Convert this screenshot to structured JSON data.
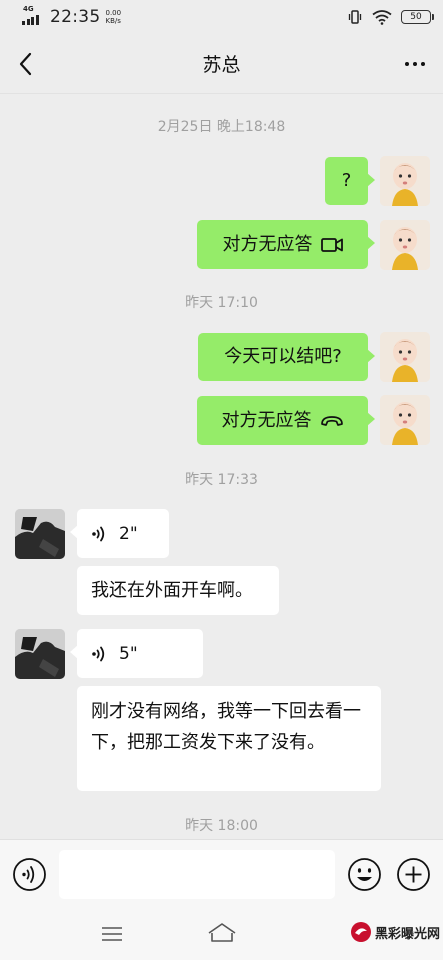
{
  "status_bar": {
    "network": "4G",
    "time": "22:35",
    "speed_value": "0.00",
    "speed_unit": "KB/s",
    "battery": "50"
  },
  "header": {
    "title": "苏总",
    "back_icon": "chevron-left-icon",
    "more_icon": "more-dots-icon"
  },
  "timestamps": {
    "t1": "2月25日 晚上18:48",
    "t2": "昨天 17:10",
    "t3": "昨天 17:33",
    "t4": "昨天 18:00"
  },
  "messages": {
    "m1": {
      "sender": "me",
      "text": "?"
    },
    "m2": {
      "sender": "me",
      "text": "对方无应答",
      "icon": "video-call-icon"
    },
    "m3": {
      "sender": "me",
      "text": "今天可以结吧?"
    },
    "m4": {
      "sender": "me",
      "text": "对方无应答",
      "icon": "phone-hangup-icon"
    },
    "m5": {
      "sender": "other",
      "type": "voice",
      "duration": "2\""
    },
    "m6": {
      "sender": "other",
      "text": "我还在外面开车啊。"
    },
    "m7": {
      "sender": "other",
      "type": "voice",
      "duration": "5\""
    },
    "m8": {
      "sender": "other",
      "text": "刚才没有网络，我等一下回去看一下，把那工资发下来了没有。"
    }
  },
  "input_bar": {
    "value": "",
    "voice_icon": "voice-mode-icon",
    "emoji_icon": "emoji-icon",
    "plus_icon": "plus-icon"
  },
  "nav_bar": {
    "menu_icon": "menu-icon",
    "home_icon": "home-icon"
  },
  "watermark": {
    "text": "黑彩曝光网"
  },
  "colors": {
    "background": "#ededed",
    "my_bubble": "#95ec69",
    "other_bubble": "#ffffff",
    "timestamp": "#a0a0a0"
  }
}
